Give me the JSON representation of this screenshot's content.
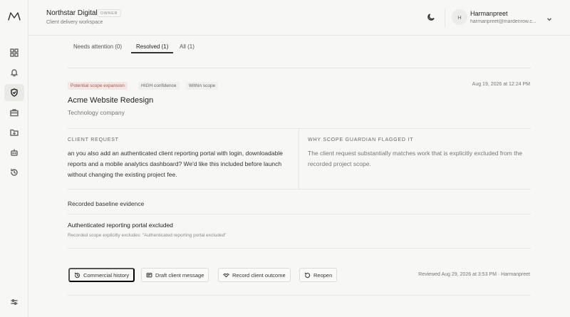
{
  "sidebar": {
    "logo_icon": "m-logo-icon",
    "items": [
      {
        "icon": "grid-icon"
      },
      {
        "icon": "bell-icon"
      },
      {
        "icon": "shield-icon",
        "active": true
      },
      {
        "icon": "briefcase-icon"
      },
      {
        "icon": "folder-icon"
      },
      {
        "icon": "robot-icon"
      },
      {
        "icon": "history-icon"
      }
    ],
    "settings_icon": "sliders-icon"
  },
  "header": {
    "workspace_name": "Northstar Digital",
    "owner_badge": "OWNER",
    "workspace_subtitle": "Client delivery workspace",
    "user_initial": "H",
    "user_name": "Harmanpreet",
    "user_email": "harmanpreet@mardenrow.c..."
  },
  "tabs": [
    {
      "label": "Needs attention (0)"
    },
    {
      "label": "Resolved (1)",
      "active": true
    },
    {
      "label": "All (1)"
    }
  ],
  "flag": {
    "badges": {
      "scope": "Potential scope expansion",
      "confidence": "HIGH confidence",
      "within": "Within scope"
    },
    "timestamp": "Aug 19, 2026 at 12:24 PM",
    "client_name": "Acme Website Redesign",
    "client_type": "Technology company",
    "client_request_label": "CLIENT REQUEST",
    "client_request_text": "an you also add an authenticated client reporting portal with login, downloadable reports and a mobile analytics dashboard? We'd like this included before launch without changing the existing project fee.",
    "why_label": "WHY SCOPE GUARDIAN FLAGGED IT",
    "why_text": "The client request substantially matches work that is explicitly excluded from the recorded project scope.",
    "baseline_title": "Recorded baseline evidence",
    "evidence_title": "Authenticated reporting portal excluded",
    "evidence_sub": "Recorded scope explicitly excludes: \"Authenticated reporting portal excluded\""
  },
  "actions": {
    "commercial_history": "Commercial history",
    "draft_message": "Draft client message",
    "record_outcome": "Record client outcome",
    "reopen": "Reopen",
    "reviewed_text": "Reviewed Aug 29, 2026 at 3:53 PM · Harmanpreet"
  },
  "colors": {
    "scope_badge_bg": "#f3e7e5",
    "scope_badge_text": "#a8574d",
    "background": "#f7f7f5"
  }
}
